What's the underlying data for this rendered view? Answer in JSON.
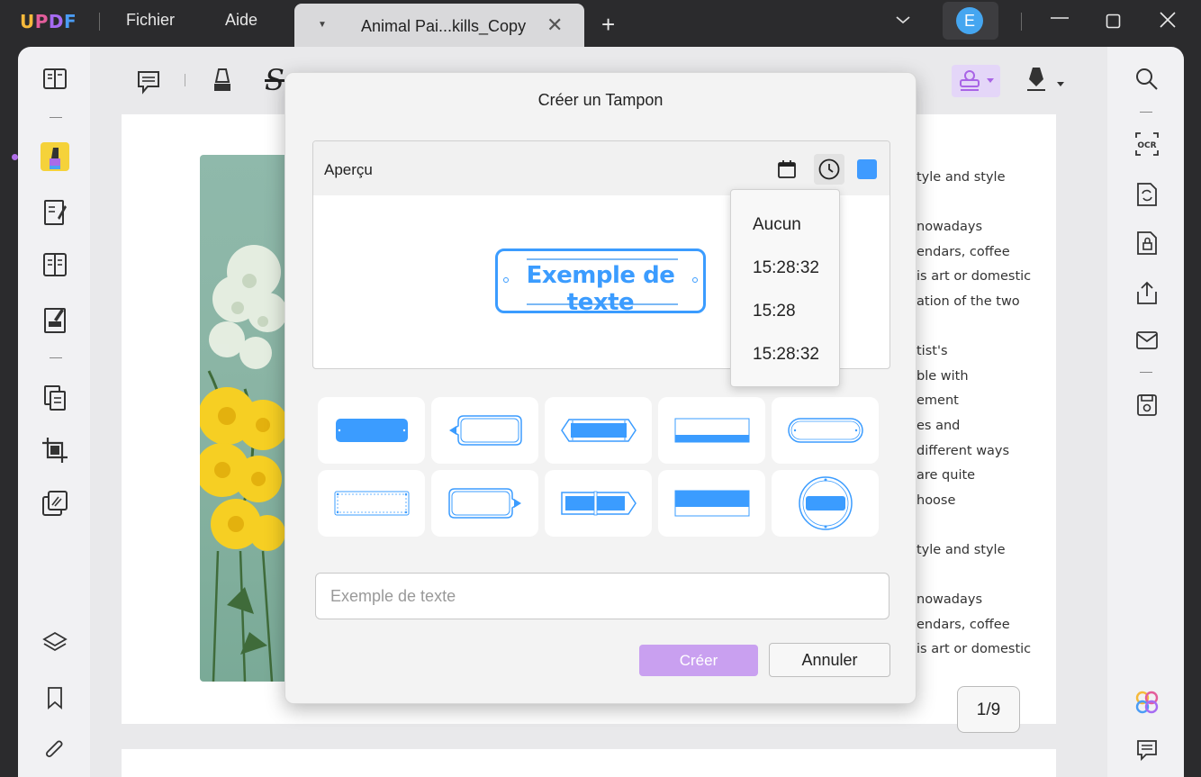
{
  "app": {
    "logo": {
      "u": "U",
      "p": "P",
      "d": "D",
      "f": "F"
    },
    "menu": {
      "file": "Fichier",
      "help": "Aide"
    },
    "tab": {
      "title": "Animal Pai...kills_Copy"
    },
    "avatar_letter": "E"
  },
  "toolbar": {
    "tools": [
      "comment-icon",
      "highlighter-icon",
      "strikethrough-icon",
      "underline-icon",
      "text-icon",
      "textbox-icon",
      "callout-icon",
      "sticky-note-icon",
      "pencil-icon",
      "shape-icon",
      "measure-icon",
      "stamp-icon",
      "signature-icon"
    ],
    "strike_label": "S"
  },
  "document": {
    "lines": [
      "tyle and style",
      "nowadays",
      "endars, coffee",
      "is art or domestic",
      "ation of the two",
      "tist's",
      "ble with",
      "ement",
      "es and",
      "different ways",
      "are quite",
      "hoose",
      "tyle and style",
      "nowadays",
      "endars, coffee",
      "is art or domestic"
    ],
    "page_indicator": "1/9"
  },
  "dialog": {
    "title": "Créer un Tampon",
    "preview_label": "Aperçu",
    "stamp_text": "Exemple de texte",
    "stamp_color": "#3b9cff",
    "input_placeholder": "Exemple de texte",
    "create_label": "Créer",
    "cancel_label": "Annuler",
    "stamp_styles": [
      "solid-rect",
      "bubble-left",
      "tag-ends",
      "banner-bar",
      "outline-rounded",
      "dotted-rect",
      "bubble-right",
      "arrow-tag",
      "double-bar",
      "circle-seal"
    ]
  },
  "time_dropdown": {
    "options": [
      "Aucun",
      "15:28:32",
      "15:28",
      "15:28:32"
    ]
  },
  "colors": {
    "accent": "#3b9cff",
    "create_button": "#c9a0f0",
    "stamp_tool_bg": "#e4d6f8"
  }
}
